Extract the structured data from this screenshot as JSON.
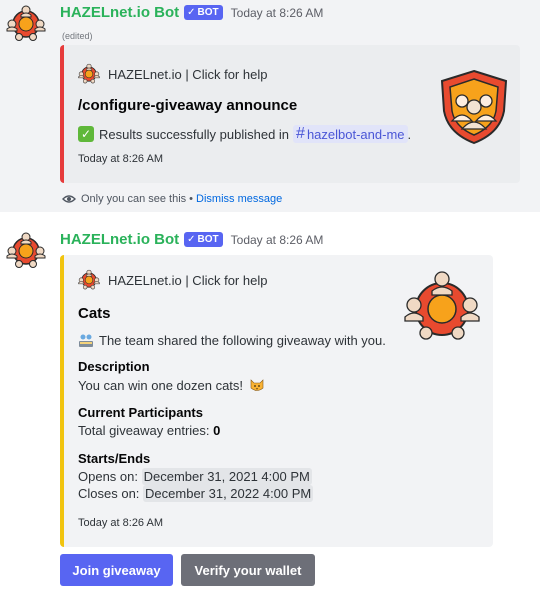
{
  "messages": [
    {
      "bot_name": "HAZELnet.io Bot",
      "badge": "BOT",
      "timestamp": "Today at 8:26 AM",
      "edited": "(edited)",
      "embed": {
        "accent_color": "#e63b3b",
        "author": "HAZELnet.io | Click for help",
        "title": "/configure-giveaway announce",
        "description_text": "Results successfully published in",
        "channel_mention": "hazelbot-and-me",
        "description_suffix": ".",
        "footer_timestamp": "Today at 8:26 AM"
      },
      "ephemeral": {
        "text": "Only you can see this",
        "separator": "•",
        "dismiss": "Dismiss message"
      }
    },
    {
      "bot_name": "HAZELnet.io Bot",
      "badge": "BOT",
      "timestamp": "Today at 8:26 AM",
      "embed": {
        "accent_color": "#f1c40f",
        "author": "HAZELnet.io | Click for help",
        "title": "Cats",
        "description": "The team shared the following giveaway with you.",
        "fields": [
          {
            "name": "Description",
            "value": "You can win one dozen cats!"
          },
          {
            "name": "Current Participants",
            "value_prefix": "Total giveaway entries:",
            "value_bold": "0"
          },
          {
            "name": "Starts/Ends",
            "opens_label": "Opens on:",
            "opens_value": "December 31, 2021 4:00 PM",
            "closes_label": "Closes on:",
            "closes_value": "December 31, 2022 4:00 PM"
          }
        ],
        "footer_timestamp": "Today at 8:26 AM"
      },
      "buttons": {
        "join": "Join giveaway",
        "verify": "Verify your wallet"
      }
    }
  ],
  "colors": {
    "bot_name": "#2ab25a",
    "blurple": "#5865f2",
    "secondary_button": "#6d6f78",
    "link": "#0068e0"
  },
  "icons": {
    "avatar": "hazelnet-community-icon",
    "eye": "eye-icon",
    "check": "check-emoji",
    "team": "team-emoji",
    "cat": "cat-emoji"
  }
}
